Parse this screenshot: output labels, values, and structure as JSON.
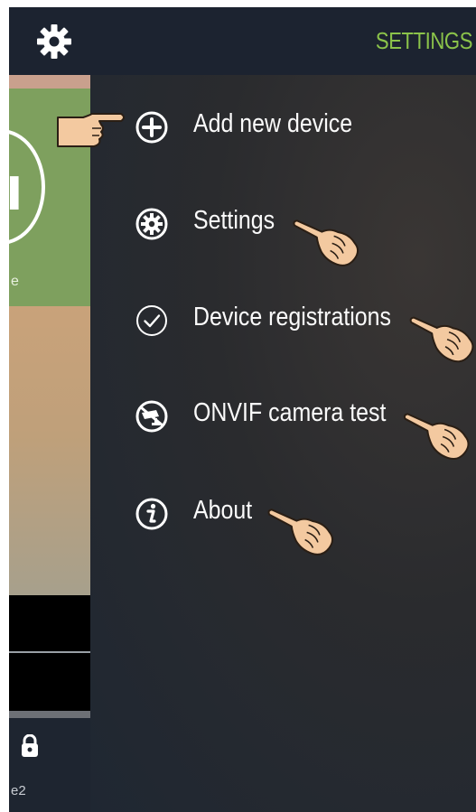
{
  "header": {
    "title": "SETTINGS",
    "settings_icon": "gear-icon",
    "accent_color": "#8bc34a"
  },
  "underlying": {
    "label_1": "e",
    "label_2": "e2",
    "lock_icon": "lock-icon"
  },
  "menu": {
    "items": [
      {
        "label": "Add new device",
        "icon": "plus-circle-icon"
      },
      {
        "label": "Settings",
        "icon": "gear-circle-icon"
      },
      {
        "label": "Device registrations",
        "icon": "check-circle-icon"
      },
      {
        "label": "ONVIF camera test",
        "icon": "camera-circle-icon"
      },
      {
        "label": "About",
        "icon": "info-circle-icon"
      }
    ]
  },
  "pointer_icon": "pointing-hand-icon"
}
